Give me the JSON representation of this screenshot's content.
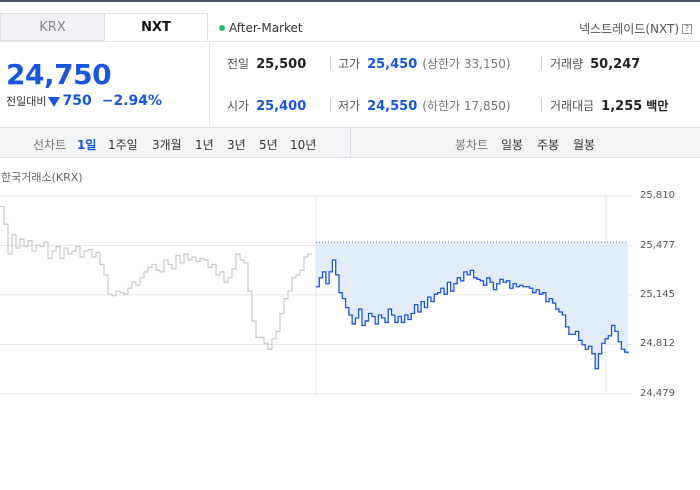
{
  "tabs": [
    {
      "label": "KRX",
      "active": false
    },
    {
      "label": "NXT",
      "active": true
    }
  ],
  "market_status": "After-Market",
  "nxt_link": "넥스트레이드(NXT)",
  "price": {
    "current": "24,750",
    "change_label": "전일대비",
    "change_value": "750",
    "change_pct": "−2.94%"
  },
  "stats": {
    "prev_close": {
      "label": "전일",
      "value": "25,500"
    },
    "open": {
      "label": "시가",
      "value": "25,400"
    },
    "high": {
      "label": "고가",
      "value": "25,450",
      "sub": "(상한가 33,150)"
    },
    "low": {
      "label": "저가",
      "value": "24,550",
      "sub": "(하한가 17,850)"
    },
    "volume": {
      "label": "거래량",
      "value": "50,247"
    },
    "amount": {
      "label": "거래대금",
      "value": "1,255",
      "unit": "백만"
    }
  },
  "toolbar": {
    "line_chart_label": "선차트",
    "periods": [
      "1일",
      "1주일",
      "3개월",
      "1년",
      "3년",
      "5년",
      "10년"
    ],
    "active_period": "1일",
    "candle_label": "봉차트",
    "candle_periods": [
      "일봉",
      "주봉",
      "월봉"
    ]
  },
  "exchange_label": "한국거래소(KRX)",
  "colors": {
    "accent": "#1a56db",
    "down": "#1a56db",
    "area_fill": "#e3ecf9",
    "pre_line": "#c8c8c8"
  },
  "chart_data": {
    "type": "line",
    "y_ticks": [
      "25,810",
      "25,477",
      "25,145",
      "24,812",
      "24,479"
    ],
    "ylim": [
      24479,
      25810
    ],
    "baseline": 25500,
    "grid": true,
    "series": [
      {
        "session": "regular",
        "values": [
          25740,
          25620,
          25420,
          25550,
          25460,
          25520,
          25470,
          25510,
          25440,
          25480,
          25470,
          25500,
          25390,
          25440,
          25470,
          25390,
          25460,
          25420,
          25440,
          25470,
          25400,
          25440,
          25450,
          25400,
          25430,
          25350,
          25280,
          25150,
          25140,
          25170,
          25160,
          25150,
          25190,
          25230,
          25210,
          25260,
          25300,
          25330,
          25350,
          25310,
          25300,
          25380,
          25350,
          25320,
          25410,
          25360,
          25420,
          25380,
          25400,
          25370,
          25390,
          25380,
          25330,
          25350,
          25280,
          25300,
          25230,
          25260,
          25320,
          25420,
          25380,
          25360,
          25170,
          24970,
          24860,
          24860,
          24820,
          24780,
          24850,
          24900,
          25020,
          25120,
          25170,
          25260,
          25280,
          25310,
          25400,
          25420,
          25420
        ]
      },
      {
        "session": "after-market",
        "values": [
          25200,
          25260,
          25300,
          25220,
          25300,
          25380,
          25280,
          25160,
          25120,
          25060,
          25010,
          24950,
          24990,
          25050,
          24940,
          24970,
          25020,
          25000,
          24950,
          25010,
          24990,
          24960,
          25050,
          25010,
          24960,
          25000,
          24960,
          25010,
          24980,
          25020,
          25080,
          25030,
          25100,
          25060,
          25130,
          25100,
          25150,
          25160,
          25190,
          25150,
          25230,
          25170,
          25220,
          25260,
          25240,
          25300,
          25280,
          25310,
          25260,
          25250,
          25240,
          25210,
          25260,
          25230,
          25180,
          25220,
          25250,
          25230,
          25240,
          25190,
          25220,
          25200,
          25210,
          25200,
          25200,
          25190,
          25160,
          25180,
          25150,
          25160,
          25100,
          25120,
          25090,
          25050,
          25030,
          25010,
          24930,
          24880,
          24880,
          24900,
          24840,
          24810,
          24780,
          24800,
          24750,
          24650,
          24750,
          24820,
          24850,
          24870,
          24940,
          24900,
          24830,
          24780,
          24760,
          24750
        ]
      }
    ]
  }
}
